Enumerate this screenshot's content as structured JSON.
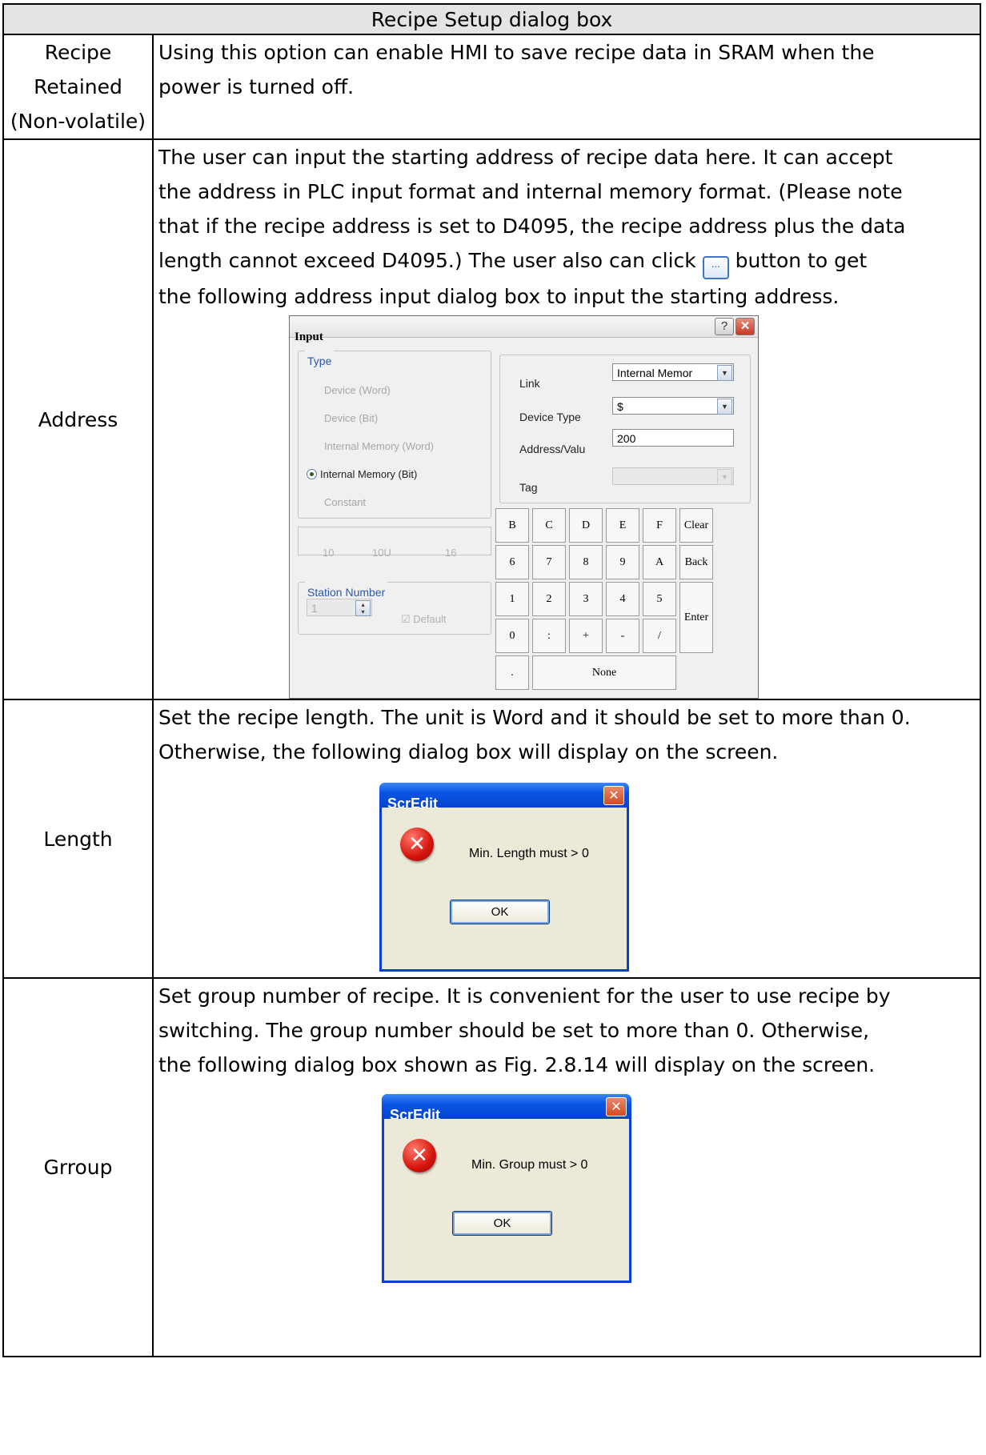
{
  "header": {
    "title": "Recipe Setup dialog box"
  },
  "rows": {
    "retained": {
      "label_lines": [
        "Recipe",
        "Retained",
        "(Non-volatile)"
      ],
      "desc_lines": [
        "Using this option can enable HMI to save recipe data in SRAM when the",
        "power is turned off."
      ]
    },
    "address": {
      "label": "Address",
      "desc_lines": [
        "The user can input the starting address of recipe data here. It can accept",
        "the address in PLC input format and internal memory format. (Please note",
        "that if the recipe address is set to D4095, the recipe address plus the data"
      ],
      "desc_line4_pre": "length cannot exceed D4095.) The user also can click",
      "desc_line4_post": "button to get",
      "desc_line5": "the following address input dialog box to input the starting address.",
      "button_icon": "…"
    },
    "length": {
      "label": "Length",
      "desc_lines": [
        "Set the recipe length. The unit is Word and it should be set to more than 0.",
        "Otherwise, the following dialog box will display on the screen."
      ]
    },
    "group": {
      "label": "Grroup",
      "desc_lines": [
        "Set group number of recipe. It is convenient for the user to use recipe by",
        "switching. The group number should be set to more than 0. Otherwise,",
        "the following dialog box shown as Fig. 2.8.14 will display on the screen."
      ]
    }
  },
  "input_dialog": {
    "title": "Input",
    "help_btn": "?",
    "close_btn": "✕",
    "type_group": "Type",
    "options": [
      "Device (Word)",
      "Device (Bit)",
      "Internal Memory (Word)",
      "Internal Memory (Bit)",
      "Constant"
    ],
    "radix": [
      "10",
      "10U",
      "16"
    ],
    "station_group": "Station Number",
    "station_value": "1",
    "default_label": "Default",
    "link_label": "Link",
    "link_value": "Internal Memor",
    "device_type_label": "Device Type",
    "device_type_value": "$",
    "address_label": "Address/Valu",
    "address_value": "200",
    "tag_label": "Tag",
    "keys_row1": [
      "B",
      "C",
      "D",
      "E",
      "F",
      "Clear"
    ],
    "keys_row2": [
      "6",
      "7",
      "8",
      "9",
      "A",
      "Back"
    ],
    "keys_row3": [
      "1",
      "2",
      "3",
      "4",
      "5"
    ],
    "keys_row4": [
      "0",
      ":",
      "+",
      "-",
      "/"
    ],
    "key_enter": "Enter",
    "key_dot": ".",
    "key_none": "None"
  },
  "length_dialog": {
    "title": "ScrEdit",
    "close": "✕",
    "icon": "✕",
    "message": "Min. Length must > 0",
    "ok": "OK"
  },
  "group_dialog": {
    "title": "ScrEdit",
    "close": "✕",
    "icon": "✕",
    "message": "Min. Group must > 0",
    "ok": "OK"
  },
  "colors": {
    "header_bg": "#e4e4e4",
    "xp_title": "#0b55e5",
    "xp_body": "#ece9d8",
    "error_red": "#d4140d"
  }
}
